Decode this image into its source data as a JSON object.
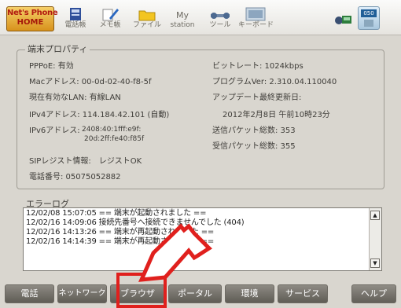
{
  "toolbar": {
    "home_line1": "Net's Phone",
    "home_line2": "HOME",
    "buttons": [
      {
        "label": "電話帳",
        "icon": "phonebook-icon"
      },
      {
        "label": "メモ帳",
        "icon": "memo-icon"
      },
      {
        "label": "ファイル",
        "icon": "folder-icon"
      },
      {
        "label": "station",
        "icon": "my-station-icon",
        "top_text": "My"
      },
      {
        "label": "ツール",
        "icon": "tools-icon"
      },
      {
        "label": "キーボード",
        "icon": "keyboard-icon"
      }
    ],
    "phone_number_badge": "050"
  },
  "props": {
    "title": "端末プロパティ",
    "pppoe": "PPPoE: 有効",
    "mac": "Macアドレス: 00-0d-02-40-f8-5f",
    "lan": "現在有効なLAN: 有線LAN",
    "ipv4": "IPv4アドレス: 114.184.42.101 (自動)",
    "ipv6_label": "IPv6アドレス:",
    "ipv6_line1": "2408:40:1fff:e9f:",
    "ipv6_line2": "20d:2ff:fe40:f85f",
    "sip": "SIPレジスト情報:　レジストOK",
    "phone": "電話番号: 05075052882",
    "bitrate": "ビットレート:  1024kbps",
    "program": "プログラムVer:  2.310.04.110040",
    "update_label": "アップデート最終更新日:",
    "update_value": "2012年2月8日 午前10時23分",
    "sent": "送信パケット総数: 353",
    "recv": "受信パケット総数: 355"
  },
  "errorlog": {
    "label": "エラーログ",
    "lines": [
      "12/02/08 15:07:05  ==  端末が起動されました  ==",
      "12/02/16 14:09:06  接続先番号へ接続できませんでした (404)",
      "12/02/16 14:13:26  ==  端末が再起動されました  ==",
      "12/02/16 14:14:39  ==  端末が再起動されました  =="
    ]
  },
  "bottom": {
    "buttons": [
      "電話",
      "ネットワーク",
      "ブラウザ",
      "ポータル",
      "環境",
      "サービス"
    ],
    "help": "ヘルプ"
  },
  "colors": {
    "highlight": "#e0201d",
    "accent": "#d8921c"
  }
}
